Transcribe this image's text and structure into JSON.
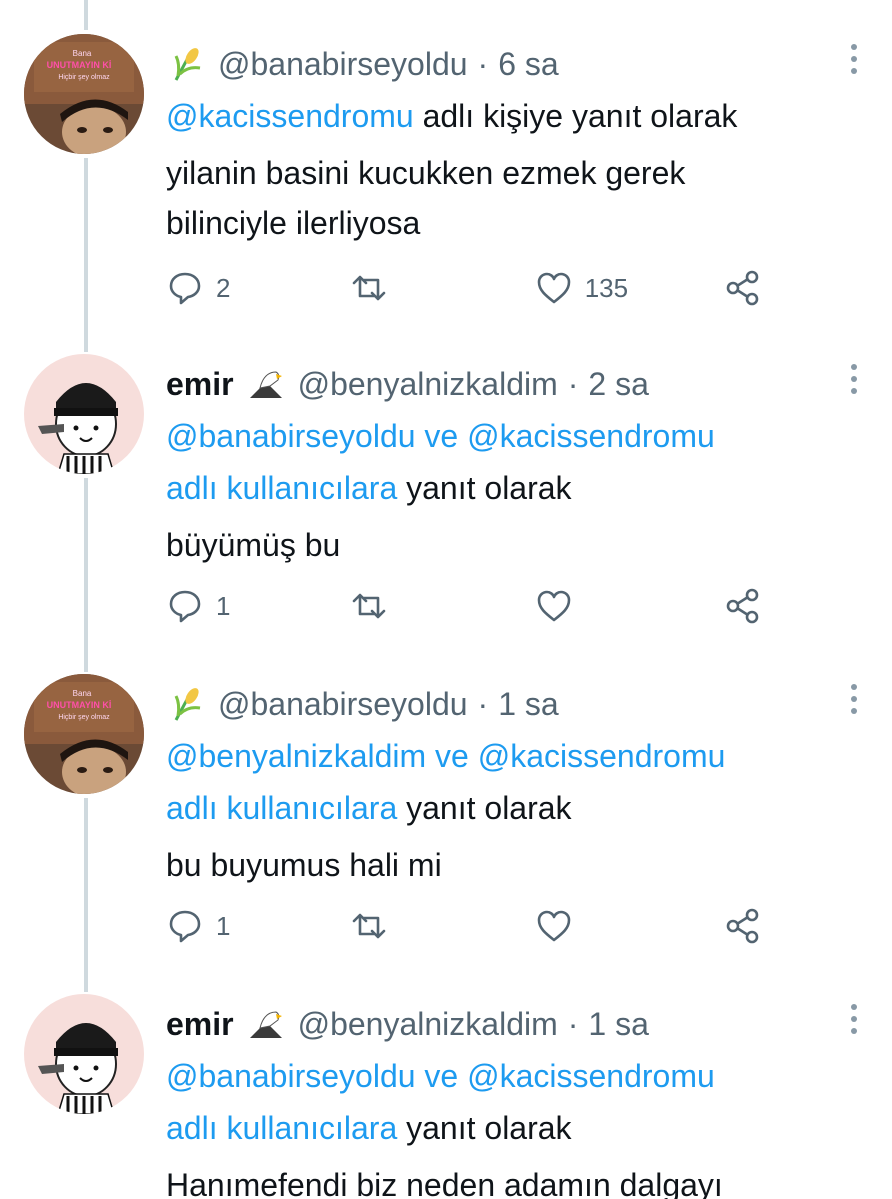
{
  "tweets": [
    {
      "display_name": "",
      "emoji": "corn-emoji",
      "handle": "@banabirseyoldu",
      "separator": "·",
      "time": "6 sa",
      "mention_1": "@kacissendromu",
      "connector": "",
      "mention_2": "",
      "reply_suffix": "adlı kişiye yanıt olarak",
      "text_lines": [
        "yilanin basini kucukken ezmek gerek",
        "bilinciyle ilerliyosa"
      ],
      "reply_count": "2",
      "like_count": "135"
    },
    {
      "display_name": "emir",
      "emoji": "eagle-emoji",
      "handle": "@benyalnizkaldim",
      "separator": "·",
      "time": "2 sa",
      "mention_1": "@banabirseyoldu",
      "connector": "ve",
      "mention_2": "@kacissendromu",
      "mention_suffix": "adlı kullanıcılara",
      "reply_suffix": "yanıt olarak",
      "text_lines": [
        "büyümüş bu"
      ],
      "reply_count": "1",
      "like_count": ""
    },
    {
      "display_name": "",
      "emoji": "corn-emoji",
      "handle": "@banabirseyoldu",
      "separator": "·",
      "time": "1 sa",
      "mention_1": "@benyalnizkaldim",
      "connector": "ve",
      "mention_2": "@kacissendromu",
      "mention_suffix": "adlı kullanıcılara",
      "reply_suffix": "yanıt olarak",
      "text_lines": [
        "bu buyumus hali mi"
      ],
      "reply_count": "1",
      "like_count": ""
    },
    {
      "display_name": "emir",
      "emoji": "eagle-emoji",
      "handle": "@benyalnizkaldim",
      "separator": "·",
      "time": "1 sa",
      "mention_1": "@banabirseyoldu",
      "connector": "ve",
      "mention_2": "@kacissendromu",
      "mention_suffix": "adlı kullanıcılara",
      "reply_suffix": "yanıt olarak",
      "text_lines": [
        "Hanımefendi biz neden adamın dalgayı"
      ],
      "reply_count": "",
      "like_count": ""
    }
  ],
  "avatar_neon_text": {
    "line1": "Bana",
    "line2": "UNUTMAYIN Kİ",
    "line3": "Hiçbir şey olmaz"
  },
  "colors": {
    "link": "#1d9bf0",
    "secondary_text": "#536471",
    "thread_line": "#cfd9de",
    "icon": "#536471"
  }
}
